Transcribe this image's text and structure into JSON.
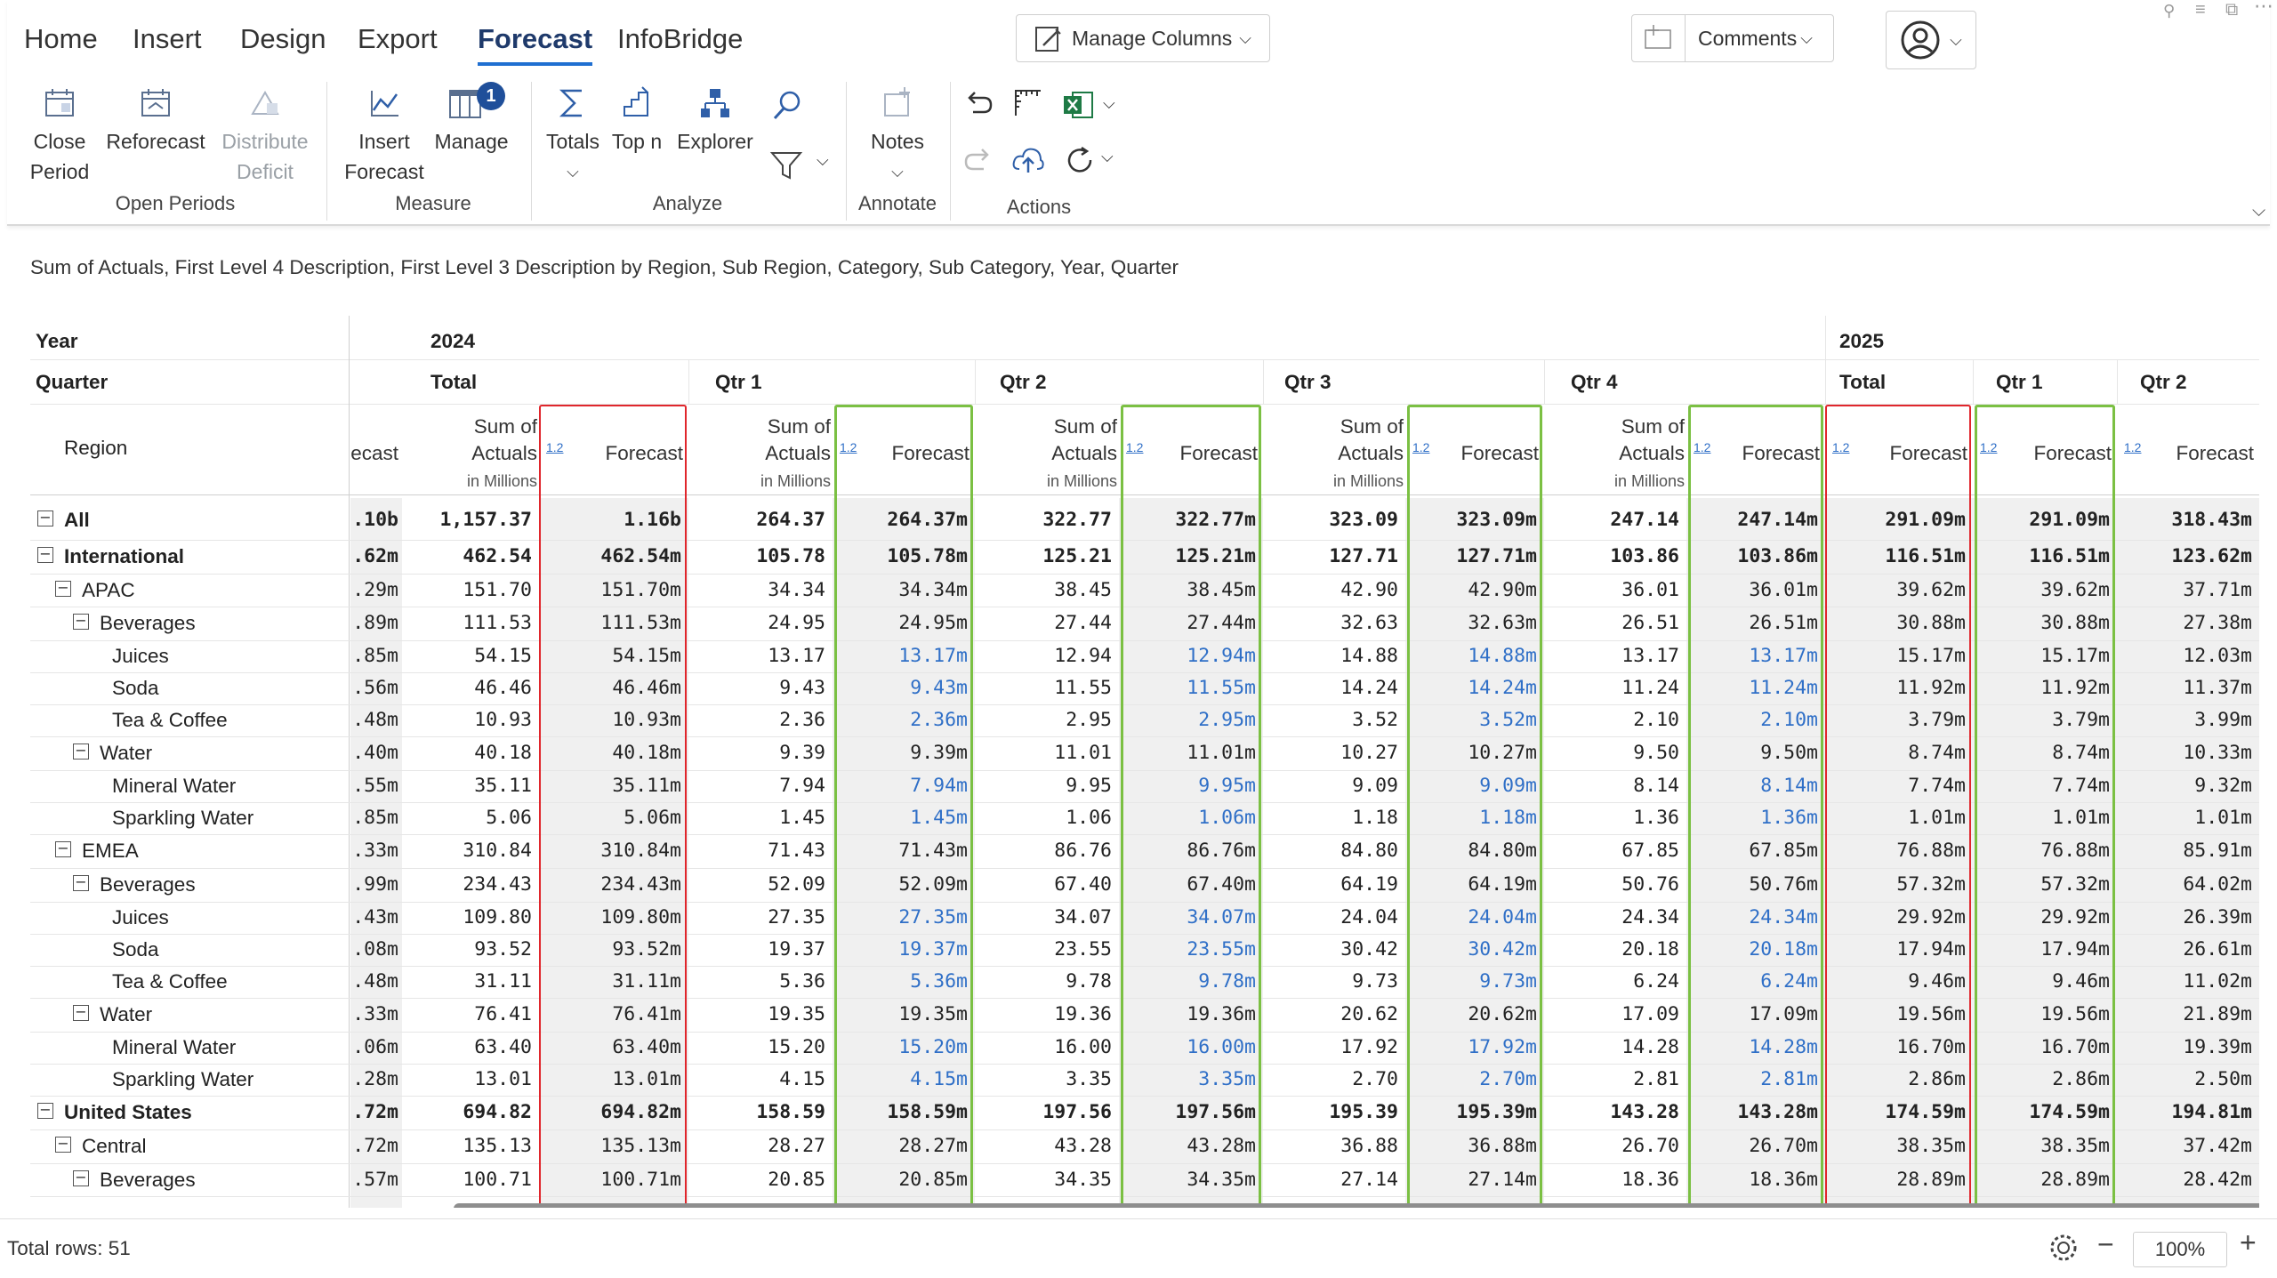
{
  "ribbon": {
    "tabs": [
      "Home",
      "Insert",
      "Design",
      "Export",
      "Forecast",
      "InfoBridge"
    ],
    "active_tab": "Forecast",
    "manage_columns_label": "Manage Columns",
    "comments_label": "Comments",
    "buttons": {
      "close_period": [
        "Close",
        "Period"
      ],
      "reforecast": "Reforecast",
      "distribute_deficit": [
        "Distribute",
        "Deficit"
      ],
      "insert_forecast": [
        "Insert",
        "Forecast"
      ],
      "manage": "Manage",
      "manage_badge": "1",
      "totals": "Totals",
      "top_n": "Top n",
      "explorer": "Explorer",
      "notes": "Notes"
    },
    "groups": [
      "Open Periods",
      "Measure",
      "Analyze",
      "Annotate",
      "Actions"
    ]
  },
  "subtitle": "Sum of Actuals, First Level 4 Description, First Level 3 Description by Region, Sub Region, Category, Sub Category, Year, Quarter",
  "grid": {
    "row_headers": [
      "Year",
      "Quarter",
      "Region"
    ],
    "years": [
      "2024",
      "2025"
    ],
    "quarters": [
      "Total",
      "Qtr 1",
      "Qtr 2",
      "Qtr 3",
      "Qtr 4",
      "Total",
      "Qtr 1",
      "Qtr 2"
    ],
    "measure_actuals": [
      "Sum of",
      "Actuals"
    ],
    "measure_actuals_unit": "in Millions",
    "measure_forecast": "Forecast",
    "partial_forecast": "ecast",
    "icon_12": "1.2",
    "rows": [
      {
        "label": "All",
        "level": 0,
        "bold": true,
        "toggle": true,
        "p": ".10b",
        "v": [
          "1,157.37",
          "1.16b",
          "264.37",
          "264.37m",
          "322.77",
          "322.77m",
          "323.09",
          "323.09m",
          "247.14",
          "247.14m",
          "291.09m",
          "291.09m",
          "318.43m"
        ]
      },
      {
        "label": "International",
        "level": 0,
        "bold": true,
        "toggle": true,
        "p": ".62m",
        "v": [
          "462.54",
          "462.54m",
          "105.78",
          "105.78m",
          "125.21",
          "125.21m",
          "127.71",
          "127.71m",
          "103.86",
          "103.86m",
          "116.51m",
          "116.51m",
          "123.62m"
        ]
      },
      {
        "label": "APAC",
        "level": 1,
        "bold": false,
        "toggle": true,
        "p": ".29m",
        "v": [
          "151.70",
          "151.70m",
          "34.34",
          "34.34m",
          "38.45",
          "38.45m",
          "42.90",
          "42.90m",
          "36.01",
          "36.01m",
          "39.62m",
          "39.62m",
          "37.71m"
        ]
      },
      {
        "label": "Beverages",
        "level": 2,
        "bold": false,
        "toggle": true,
        "p": ".89m",
        "v": [
          "111.53",
          "111.53m",
          "24.95",
          "24.95m",
          "27.44",
          "27.44m",
          "32.63",
          "32.63m",
          "26.51",
          "26.51m",
          "30.88m",
          "30.88m",
          "27.38m"
        ]
      },
      {
        "label": "Juices",
        "level": 3,
        "bold": false,
        "toggle": false,
        "leaf": true,
        "p": ".85m",
        "v": [
          "54.15",
          "54.15m",
          "13.17",
          "13.17m",
          "12.94",
          "12.94m",
          "14.88",
          "14.88m",
          "13.17",
          "13.17m",
          "15.17m",
          "15.17m",
          "12.03m"
        ]
      },
      {
        "label": "Soda",
        "level": 3,
        "bold": false,
        "toggle": false,
        "leaf": true,
        "p": ".56m",
        "v": [
          "46.46",
          "46.46m",
          "9.43",
          "9.43m",
          "11.55",
          "11.55m",
          "14.24",
          "14.24m",
          "11.24",
          "11.24m",
          "11.92m",
          "11.92m",
          "11.37m"
        ]
      },
      {
        "label": "Tea & Coffee",
        "level": 3,
        "bold": false,
        "toggle": false,
        "leaf": true,
        "p": ".48m",
        "v": [
          "10.93",
          "10.93m",
          "2.36",
          "2.36m",
          "2.95",
          "2.95m",
          "3.52",
          "3.52m",
          "2.10",
          "2.10m",
          "3.79m",
          "3.79m",
          "3.99m"
        ]
      },
      {
        "label": "Water",
        "level": 2,
        "bold": false,
        "toggle": true,
        "p": ".40m",
        "v": [
          "40.18",
          "40.18m",
          "9.39",
          "9.39m",
          "11.01",
          "11.01m",
          "10.27",
          "10.27m",
          "9.50",
          "9.50m",
          "8.74m",
          "8.74m",
          "10.33m"
        ]
      },
      {
        "label": "Mineral Water",
        "level": 3,
        "bold": false,
        "toggle": false,
        "leaf": true,
        "p": ".55m",
        "v": [
          "35.11",
          "35.11m",
          "7.94",
          "7.94m",
          "9.95",
          "9.95m",
          "9.09",
          "9.09m",
          "8.14",
          "8.14m",
          "7.74m",
          "7.74m",
          "9.32m"
        ]
      },
      {
        "label": "Sparkling Water",
        "level": 3,
        "bold": false,
        "toggle": false,
        "leaf": true,
        "p": ".85m",
        "v": [
          "5.06",
          "5.06m",
          "1.45",
          "1.45m",
          "1.06",
          "1.06m",
          "1.18",
          "1.18m",
          "1.36",
          "1.36m",
          "1.01m",
          "1.01m",
          "1.01m"
        ]
      },
      {
        "label": "EMEA",
        "level": 1,
        "bold": false,
        "toggle": true,
        "p": ".33m",
        "v": [
          "310.84",
          "310.84m",
          "71.43",
          "71.43m",
          "86.76",
          "86.76m",
          "84.80",
          "84.80m",
          "67.85",
          "67.85m",
          "76.88m",
          "76.88m",
          "85.91m"
        ]
      },
      {
        "label": "Beverages",
        "level": 2,
        "bold": false,
        "toggle": true,
        "p": ".99m",
        "v": [
          "234.43",
          "234.43m",
          "52.09",
          "52.09m",
          "67.40",
          "67.40m",
          "64.19",
          "64.19m",
          "50.76",
          "50.76m",
          "57.32m",
          "57.32m",
          "64.02m"
        ]
      },
      {
        "label": "Juices",
        "level": 3,
        "bold": false,
        "toggle": false,
        "leaf": true,
        "p": ".43m",
        "v": [
          "109.80",
          "109.80m",
          "27.35",
          "27.35m",
          "34.07",
          "34.07m",
          "24.04",
          "24.04m",
          "24.34",
          "24.34m",
          "29.92m",
          "29.92m",
          "26.39m"
        ]
      },
      {
        "label": "Soda",
        "level": 3,
        "bold": false,
        "toggle": false,
        "leaf": true,
        "p": ".08m",
        "v": [
          "93.52",
          "93.52m",
          "19.37",
          "19.37m",
          "23.55",
          "23.55m",
          "30.42",
          "30.42m",
          "20.18",
          "20.18m",
          "17.94m",
          "17.94m",
          "26.61m"
        ]
      },
      {
        "label": "Tea & Coffee",
        "level": 3,
        "bold": false,
        "toggle": false,
        "leaf": true,
        "p": ".48m",
        "v": [
          "31.11",
          "31.11m",
          "5.36",
          "5.36m",
          "9.78",
          "9.78m",
          "9.73",
          "9.73m",
          "6.24",
          "6.24m",
          "9.46m",
          "9.46m",
          "11.02m"
        ]
      },
      {
        "label": "Water",
        "level": 2,
        "bold": false,
        "toggle": true,
        "p": ".33m",
        "v": [
          "76.41",
          "76.41m",
          "19.35",
          "19.35m",
          "19.36",
          "19.36m",
          "20.62",
          "20.62m",
          "17.09",
          "17.09m",
          "19.56m",
          "19.56m",
          "21.89m"
        ]
      },
      {
        "label": "Mineral Water",
        "level": 3,
        "bold": false,
        "toggle": false,
        "leaf": true,
        "p": ".06m",
        "v": [
          "63.40",
          "63.40m",
          "15.20",
          "15.20m",
          "16.00",
          "16.00m",
          "17.92",
          "17.92m",
          "14.28",
          "14.28m",
          "16.70m",
          "16.70m",
          "19.39m"
        ]
      },
      {
        "label": "Sparkling Water",
        "level": 3,
        "bold": false,
        "toggle": false,
        "leaf": true,
        "p": ".28m",
        "v": [
          "13.01",
          "13.01m",
          "4.15",
          "4.15m",
          "3.35",
          "3.35m",
          "2.70",
          "2.70m",
          "2.81",
          "2.81m",
          "2.86m",
          "2.86m",
          "2.50m"
        ]
      },
      {
        "label": "United States",
        "level": 0,
        "bold": true,
        "toggle": true,
        "p": ".72m",
        "v": [
          "694.82",
          "694.82m",
          "158.59",
          "158.59m",
          "197.56",
          "197.56m",
          "195.39",
          "195.39m",
          "143.28",
          "143.28m",
          "174.59m",
          "174.59m",
          "194.81m"
        ]
      },
      {
        "label": "Central",
        "level": 1,
        "bold": false,
        "toggle": true,
        "p": ".72m",
        "v": [
          "135.13",
          "135.13m",
          "28.27",
          "28.27m",
          "43.28",
          "43.28m",
          "36.88",
          "36.88m",
          "26.70",
          "26.70m",
          "38.35m",
          "38.35m",
          "37.42m"
        ]
      },
      {
        "label": "Beverages",
        "level": 2,
        "bold": false,
        "toggle": true,
        "p": ".57m",
        "v": [
          "100.71",
          "100.71m",
          "20.85",
          "20.85m",
          "34.35",
          "34.35m",
          "27.14",
          "27.14m",
          "18.36",
          "18.36m",
          "28.89m",
          "28.89m",
          "28.42m"
        ]
      }
    ]
  },
  "status": {
    "total_rows": "Total rows: 51",
    "zoom": "100%"
  },
  "colors": {
    "accent": "#1f6fd1",
    "red_box": "#e0262c",
    "green_box": "#7bc043",
    "blue_value": "#2f6fc7"
  }
}
